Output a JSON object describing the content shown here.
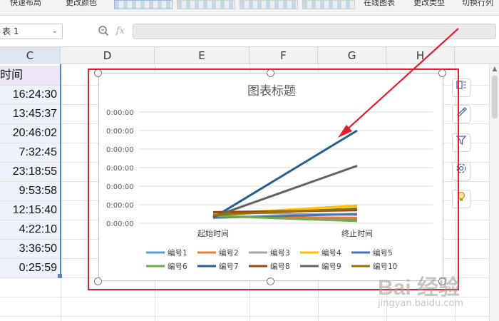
{
  "ribbon": {
    "left_label": "快速布局",
    "change_color_label": "更改颜色",
    "online_chart_label": "在线图表",
    "change_type_label": "更改类型",
    "switch_row_col_label": "切换行列"
  },
  "formula_bar": {
    "name_box": "表 1",
    "zoom_icon": "magnifier-icon",
    "fx_label": "fx",
    "formula_value": ""
  },
  "columns": [
    "C",
    "D",
    "E",
    "F",
    "G",
    "H"
  ],
  "sheet": {
    "header_cell": "时间",
    "times": [
      "16:24:30",
      "13:45:37",
      "20:46:02",
      "7:32:45",
      "23:18:55",
      "9:53:58",
      "12:15:40",
      "4:22:10",
      "3:36:50",
      "0:25:59"
    ]
  },
  "side_tools": [
    "chart-elements-icon",
    "chart-style-icon",
    "chart-filter-icon",
    "chart-settings-icon",
    "chart-idea-icon"
  ],
  "watermark": {
    "brand": "Bai 经验",
    "url": "jingyan.baidu.com"
  },
  "annotation_color": "#e0202a",
  "chart_data": {
    "type": "line",
    "title": "图表标题",
    "categories": [
      "起始时间",
      "终止时间"
    ],
    "y_tick_labels": [
      "0:00:00",
      "0:00:00",
      "0:00:00",
      "0:00:00",
      "0:00:00",
      "0:00:00",
      "0:00:00"
    ],
    "ylim": [
      0,
      6
    ],
    "grid": true,
    "legend_position": "bottom",
    "series": [
      {
        "name": "编号1",
        "color": "#5b9bd5",
        "values": [
          0.4,
          0.2
        ]
      },
      {
        "name": "编号2",
        "color": "#ed7d31",
        "values": [
          0.35,
          0.3
        ]
      },
      {
        "name": "编号3",
        "color": "#a5a5a5",
        "values": [
          0.6,
          0.45
        ]
      },
      {
        "name": "编号4",
        "color": "#ffc000",
        "values": [
          0.5,
          0.95
        ]
      },
      {
        "name": "编号5",
        "color": "#4472c4",
        "values": [
          0.3,
          0.5
        ]
      },
      {
        "name": "编号6",
        "color": "#70ad47",
        "values": [
          0.4,
          0.12
        ]
      },
      {
        "name": "编号7",
        "color": "#255e91",
        "values": [
          0.3,
          5.0
        ]
      },
      {
        "name": "编号8",
        "color": "#9e480e",
        "values": [
          0.6,
          0.7
        ]
      },
      {
        "name": "编号9",
        "color": "#636363",
        "values": [
          0.35,
          3.1
        ]
      },
      {
        "name": "编号10",
        "color": "#997300",
        "values": [
          0.45,
          0.8
        ]
      }
    ]
  }
}
